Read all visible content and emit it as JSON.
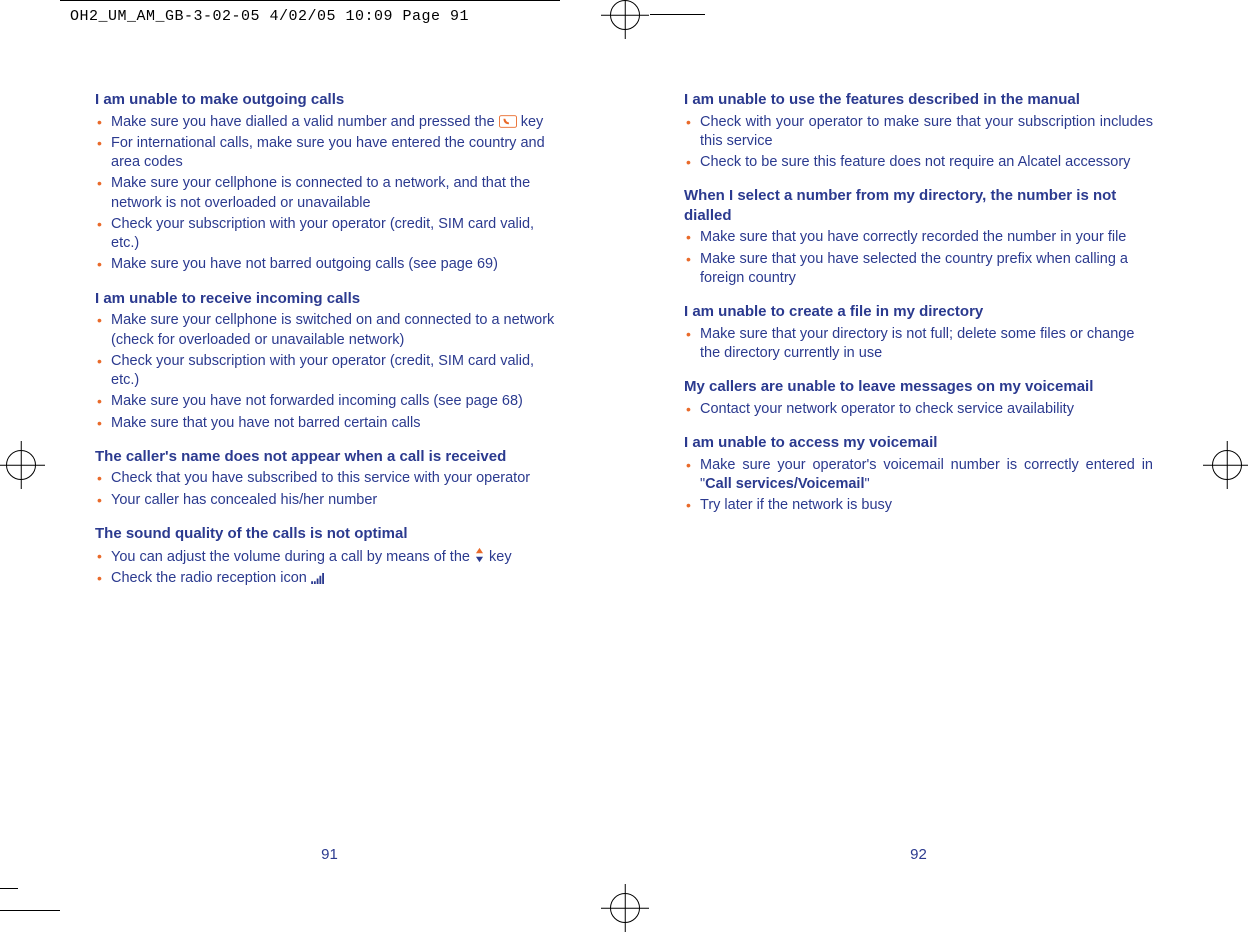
{
  "slug": "OH2_UM_AM_GB-3-02-05   4/02/05  10:09  Page 91",
  "left": {
    "folio": "91",
    "sections": [
      {
        "heading": "I am unable to make outgoing calls",
        "items": [
          {
            "pre": "Make sure you have dialled a valid number and pressed the ",
            "icon": "call-key-icon",
            "post": " key"
          },
          {
            "pre": "For international calls, make sure you have entered the country and area codes"
          },
          {
            "pre": "Make sure your cellphone is connected to a network, and that the network is not overloaded or unavailable"
          },
          {
            "pre": "Check your subscription with your operator (credit, SIM card valid, etc.)"
          },
          {
            "pre": "Make sure you have not barred outgoing calls (see page 69)"
          }
        ]
      },
      {
        "heading": "I am unable to receive incoming calls",
        "items": [
          {
            "pre": "Make sure your cellphone is switched on and connected to a network (check for overloaded or unavailable network)"
          },
          {
            "pre": "Check your subscription with your operator (credit, SIM card valid, etc.)"
          },
          {
            "pre": "Make sure you have not forwarded incoming calls (see page 68)"
          },
          {
            "pre": "Make sure that you have not barred certain calls"
          }
        ]
      },
      {
        "heading": "The caller's name does not appear when a call is received",
        "items": [
          {
            "pre": "Check that you have subscribed to this service with your operator"
          },
          {
            "pre": "Your caller has concealed his/her number"
          }
        ]
      },
      {
        "heading": "The sound quality of the calls is not optimal",
        "items": [
          {
            "pre": "You can adjust the volume during a call by means of the ",
            "icon": "volume-key-icon",
            "post": " key"
          },
          {
            "pre": "Check the radio reception icon ",
            "icon": "signal-icon"
          }
        ]
      }
    ]
  },
  "right": {
    "folio": "92",
    "sections": [
      {
        "heading": "I am unable to use the features described in the manual",
        "justify": true,
        "items": [
          {
            "pre": "Check with your operator to make sure that your subscription includes this service"
          },
          {
            "pre": "Check to be sure this feature does not require an Alcatel accessory"
          }
        ]
      },
      {
        "heading": "When I select a number from my directory, the number is not dialled",
        "items": [
          {
            "pre": "Make sure that you have correctly recorded the number in your file"
          },
          {
            "pre": "Make sure that you have selected the country prefix when calling a foreign country"
          }
        ]
      },
      {
        "heading": "I am unable to create a file in my directory",
        "items": [
          {
            "pre": "Make sure that your directory is not full; delete some files or change the directory currently in use"
          }
        ]
      },
      {
        "heading": "My callers are unable to leave messages on my voicemail",
        "items": [
          {
            "pre": "Contact your network operator to check service availability"
          }
        ]
      },
      {
        "heading": "I am unable to access my voicemail",
        "justify": true,
        "items": [
          {
            "pre": "Make sure your operator's voicemail number is correctly entered in \"",
            "bold": "Call services/Voicemail",
            "post": "\""
          },
          {
            "pre": "Try later if the network is busy"
          }
        ]
      }
    ]
  }
}
